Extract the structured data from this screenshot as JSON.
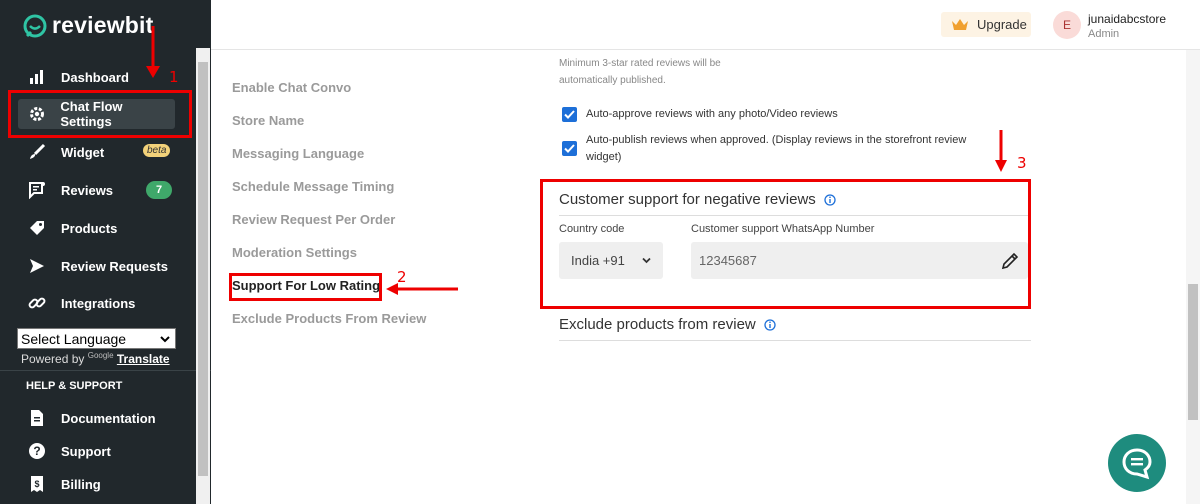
{
  "app": {
    "name": "reviewbit"
  },
  "sidebar": {
    "items": [
      {
        "label": "Dashboard",
        "icon": "bar-chart-icon"
      },
      {
        "label": "Chat Flow Settings",
        "icon": "gear-icon"
      },
      {
        "label": "Widget",
        "icon": "brush-icon",
        "badge": "beta"
      },
      {
        "label": "Reviews",
        "icon": "reviews-icon",
        "badge": "7"
      },
      {
        "label": "Products",
        "icon": "tag-icon"
      },
      {
        "label": "Review Requests",
        "icon": "send-icon"
      },
      {
        "label": "Integrations",
        "icon": "link-icon"
      }
    ],
    "language_select": "Select Language",
    "powered_by": "Powered by",
    "google": "Google",
    "translate": "Translate",
    "help_header": "HELP & SUPPORT",
    "help_items": [
      {
        "label": "Documentation",
        "icon": "document-icon"
      },
      {
        "label": "Support",
        "icon": "help-icon"
      },
      {
        "label": "Billing",
        "icon": "billing-icon"
      }
    ]
  },
  "topbar": {
    "upgrade_label": "Upgrade",
    "avatar_initial": "E",
    "username": "junaidabcstore",
    "role": "Admin"
  },
  "settings_nav": [
    "Enable Chat Convo",
    "Store Name",
    "Messaging Language",
    "Schedule Message Timing",
    "Review Request Per Order",
    "Moderation Settings",
    "Support For Low Rating",
    "Exclude Products From Review"
  ],
  "moderation": {
    "hint": "Minimum 3-star rated reviews will be automatically published.",
    "auto_approve": "Auto-approve reviews with any photo/Video reviews",
    "auto_publish": "Auto-publish reviews when approved. (Display reviews in the storefront review widget)"
  },
  "support": {
    "title": "Customer support for negative reviews",
    "country_label": "Country code",
    "country_value": "India +91",
    "whatsapp_label": "Customer support WhatsApp Number",
    "whatsapp_value": "12345687"
  },
  "exclude": {
    "title": "Exclude products from review"
  },
  "annotations": {
    "one": "1",
    "two": "2",
    "three": "3"
  },
  "colors": {
    "sidebar": "#21282c",
    "accent": "#1d6fd8",
    "highlight": "#e00000",
    "fab": "#1e8c7e"
  }
}
